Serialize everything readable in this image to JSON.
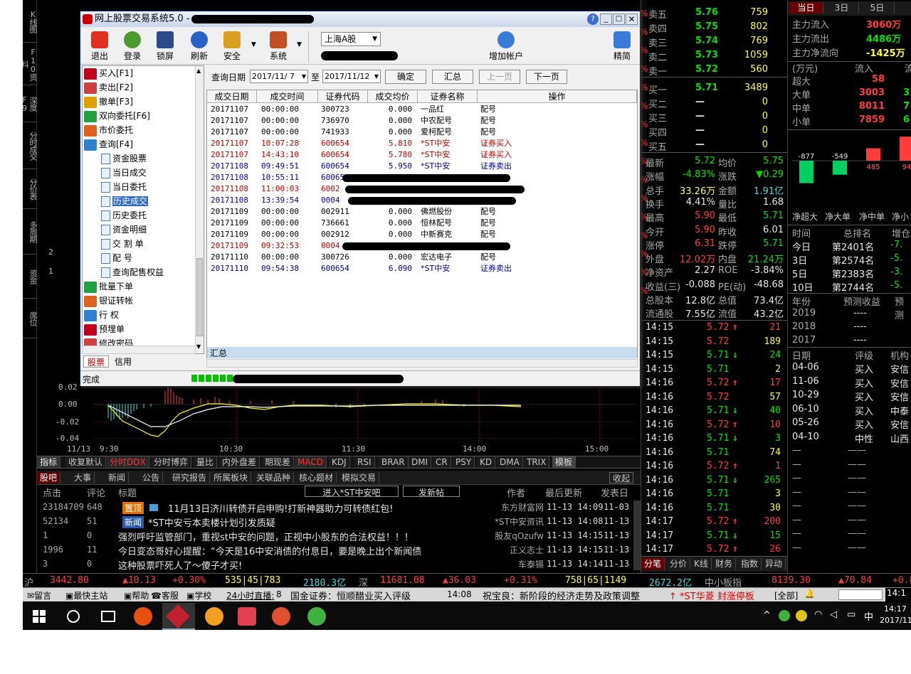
{
  "left_tabs": [
    "K线图",
    "F10资料",
    "深度F9",
    "分时成交",
    "分价表",
    "多周期",
    "资金",
    "席位"
  ],
  "chart": {
    "y_labels": [
      "0.02",
      "0.00",
      "-0.02",
      "-0.04"
    ],
    "x_labels": [
      "11/13",
      "9:30",
      "10:30",
      "11:30",
      "14:00",
      "15:00"
    ],
    "side_labels": [
      "2",
      "1"
    ]
  },
  "indicator_tabs": [
    "指标",
    "收复默认",
    "分时DDX",
    "分时博弈",
    "量比",
    "内外盘差",
    "期现差",
    "MACD",
    "KDJ",
    "RSI",
    "BRAR",
    "DMI",
    "CR",
    "PSY",
    "KD",
    "DMA",
    "TRIX",
    "模板"
  ],
  "news": {
    "tabs": [
      "股吧",
      "大事",
      "新闻",
      "公告",
      "研究报告",
      "所属板块",
      "关联品种",
      "核心题材",
      "模拟交易"
    ],
    "collapse": "收起",
    "headers": {
      "clicks": "点击",
      "comments": "评论",
      "title": "标题",
      "enter": "进入*ST中安吧",
      "post": "发新帖",
      "author": "作者",
      "updated": "最后更新",
      "posted": "发表日"
    },
    "rows": [
      {
        "clicks": "23184709",
        "comments": "648",
        "badge": "置顶",
        "title": "11月13日济川转债开启申购!打新神器助力可转债红包!",
        "author": "东方财富网",
        "updated": "11-13 14:09",
        "posted": "11-03"
      },
      {
        "clicks": "52134",
        "comments": "51",
        "badge": "新闻",
        "title": "*ST中安亏本卖楼计划引发质疑",
        "author": "*ST中安资讯",
        "updated": "11-13 14:08",
        "posted": "11-13"
      },
      {
        "clicks": "1",
        "comments": "0",
        "badge": "",
        "title": "强烈呼吁监管部门，重视st中安的问题，正视中小股东的合法权益！！！",
        "author": "股友qOzufw",
        "updated": "11-13 14:15",
        "posted": "11-13"
      },
      {
        "clicks": "1996",
        "comments": "11",
        "badge": "",
        "title": "今日变态哥好心提醒：“今天是16中安消债的付息日，要是晚上出个新闻债",
        "author": "正义志士",
        "updated": "11-13 14:15",
        "posted": "11-13"
      },
      {
        "clicks": "3",
        "comments": "0",
        "badge": "",
        "title": "这种股票吓死人了～傻子才买!",
        "author": "车泰锡",
        "updated": "11-13 14:14",
        "posted": "11-13"
      }
    ]
  },
  "quote": {
    "sell": [
      {
        "label": "卖五",
        "price": "5.76",
        "vol": "759"
      },
      {
        "label": "卖四",
        "price": "5.75",
        "vol": "802"
      },
      {
        "label": "卖三",
        "price": "5.74",
        "vol": "769"
      },
      {
        "label": "卖二",
        "price": "5.73",
        "vol": "1059"
      },
      {
        "label": "卖一",
        "price": "5.72",
        "vol": "560"
      }
    ],
    "buy": [
      {
        "label": "买一",
        "price": "5.71",
        "vol": "3489"
      },
      {
        "label": "买二",
        "price": "—",
        "vol": "0"
      },
      {
        "label": "买三",
        "price": "—",
        "vol": "0"
      },
      {
        "label": "买四",
        "price": "—",
        "vol": "0"
      },
      {
        "label": "买五",
        "price": "—",
        "vol": "0"
      }
    ],
    "stats": [
      {
        "l1": "最新",
        "v1": "5.72",
        "l2": "均价",
        "v2": "5.75"
      },
      {
        "l1": "涨幅",
        "v1": "-4.83%",
        "l2": "涨跌",
        "v2": "▼0.29"
      },
      {
        "l1": "总手",
        "v1": "33.26万",
        "l2": "金额",
        "v2": "1.91亿"
      },
      {
        "l1": "换手",
        "v1": "4.41%",
        "l2": "量比",
        "v2": "1.68"
      },
      {
        "l1": "最高",
        "v1": "5.90",
        "l2": "最低",
        "v2": "5.71"
      },
      {
        "l1": "今开",
        "v1": "5.90",
        "l2": "昨收",
        "v2": "6.01"
      },
      {
        "l1": "涨停",
        "v1": "6.31",
        "l2": "跌停",
        "v2": "5.71"
      },
      {
        "l1": "外盘",
        "v1": "12.02万",
        "l2": "内盘",
        "v2": "21.24万"
      },
      {
        "l1": "净资产",
        "v1": "2.27",
        "l2": "ROE",
        "v2": "-3.84%"
      },
      {
        "l1": "收益(三)",
        "v1": "-0.088",
        "l2": "PE(动)",
        "v2": "-48.68"
      },
      {
        "l1": "总股本",
        "v1": "12.8亿",
        "l2": "总值",
        "v2": "73.4亿"
      },
      {
        "l1": "流通股",
        "v1": "7.55亿",
        "l2": "流值",
        "v2": "43.2亿"
      }
    ],
    "ticks": [
      {
        "t": "14:15",
        "p": "5.72",
        "a": "↑",
        "v": "21"
      },
      {
        "t": "14:15",
        "p": "5.72",
        "a": "",
        "v": "189"
      },
      {
        "t": "14:15",
        "p": "5.71",
        "a": "↓",
        "v": "24"
      },
      {
        "t": "14:15",
        "p": "5.71",
        "a": "",
        "v": "2"
      },
      {
        "t": "14:16",
        "p": "5.72",
        "a": "↑",
        "v": "17"
      },
      {
        "t": "14:16",
        "p": "5.72",
        "a": "",
        "v": "57"
      },
      {
        "t": "14:16",
        "p": "5.71",
        "a": "↓",
        "v": "40"
      },
      {
        "t": "14:16",
        "p": "5.72",
        "a": "↑",
        "v": "10"
      },
      {
        "t": "14:16",
        "p": "5.71",
        "a": "↓",
        "v": "3"
      },
      {
        "t": "14:16",
        "p": "5.71",
        "a": "",
        "v": "74"
      },
      {
        "t": "14:16",
        "p": "5.72",
        "a": "↑",
        "v": "1"
      },
      {
        "t": "14:16",
        "p": "5.71",
        "a": "↓",
        "v": "265"
      },
      {
        "t": "14:16",
        "p": "5.71",
        "a": "",
        "v": "3"
      },
      {
        "t": "14:16",
        "p": "5.71",
        "a": "",
        "v": "30"
      },
      {
        "t": "14:17",
        "p": "5.72",
        "a": "↑",
        "v": "200"
      },
      {
        "t": "14:17",
        "p": "5.71",
        "a": "↓",
        "v": "15"
      },
      {
        "t": "14:17",
        "p": "5.72",
        "a": "↑",
        "v": "26"
      }
    ],
    "bottom_tabs": [
      "分笔",
      "分价",
      "K线",
      "财务",
      "指数",
      "异动"
    ],
    "side_pct": [
      "%",
      "%",
      "%",
      "%",
      "%",
      "%",
      "%",
      "%",
      "%",
      "%",
      "%",
      "%",
      "%",
      "%",
      "%",
      "%"
    ]
  },
  "fund": {
    "tabs": [
      "当日",
      "3日",
      "5日"
    ],
    "rows": [
      {
        "label": "主力流入",
        "value": "3060万"
      },
      {
        "label": "主力流出",
        "value": "4486万"
      },
      {
        "label": "主力净流向",
        "value": "-1425万"
      }
    ],
    "head": {
      "unit": "(万元)",
      "in": "流入",
      "out": "流"
    },
    "size_rows": [
      {
        "label": "超大",
        "in": "58",
        "out": ""
      },
      {
        "label": "大单",
        "in": "3003",
        "out": "3"
      },
      {
        "label": "中单",
        "in": "8011",
        "out": "7"
      },
      {
        "label": "小单",
        "in": "7859",
        "out": "6"
      }
    ],
    "bars": [
      {
        "label": "-877",
        "value": -877
      },
      {
        "label": "-549",
        "value": -549
      },
      {
        "label": "485",
        "value": 485
      },
      {
        "label": "94",
        "value": 940
      }
    ],
    "bar_labels": [
      "净超大",
      "净大单",
      "净中单",
      "净小"
    ],
    "rank_head": {
      "time": "时间",
      "rank": "总排名",
      "chg": "增仓"
    },
    "ranks": [
      {
        "t": "今日",
        "r": "第2401名",
        "c": "-7."
      },
      {
        "t": "3日",
        "r": "第2574名",
        "c": "-5."
      },
      {
        "t": "5日",
        "r": "第2383名",
        "c": "-3."
      },
      {
        "t": "10日",
        "r": "第2744名",
        "c": "-5."
      }
    ],
    "eps_head": {
      "year": "年份",
      "eps": "预测收益",
      "pred": "预测"
    },
    "eps": [
      {
        "y": "2019",
        "v": "----"
      },
      {
        "y": "2018",
        "v": "----"
      },
      {
        "y": "2017",
        "v": "----"
      }
    ],
    "rating_head": {
      "date": "日期",
      "rate": "评级",
      "org": "机构"
    },
    "ratings": [
      {
        "d": "04-06",
        "r": "买入",
        "o": "安信"
      },
      {
        "d": "11-06",
        "r": "买入",
        "o": "安信"
      },
      {
        "d": "10-29",
        "r": "买入",
        "o": "安信"
      },
      {
        "d": "06-10",
        "r": "买入",
        "o": "中泰"
      },
      {
        "d": "05-26",
        "r": "买入",
        "o": "安信"
      },
      {
        "d": "04-10",
        "r": "中性",
        "o": "山西"
      }
    ],
    "dashes": [
      "—",
      "—",
      "—",
      "—",
      "—",
      "—",
      "—",
      "—"
    ]
  },
  "status_bar": {
    "sh_label": "沪",
    "sh_index": "3442.80",
    "sh_chg": "▲10.13",
    "sh_pct": "+0.30%",
    "sh_updown": "535|45|783",
    "sh_amount": "2180.3亿",
    "sz_label": "深",
    "sz_index": "11681.08",
    "sz_chg": "▲36.03",
    "sz_pct": "+0.31%",
    "sz_updown": "758|65|1149",
    "sz_amount": "2672.2亿",
    "zxb_label": "中小板指",
    "zxb_index": "8139.30",
    "zxb_chg": "▲70.84",
    "zxb_pct": "+0.8"
  },
  "ticker": {
    "items": [
      "留言",
      "最快主站",
      "帮助",
      "客服",
      "学校"
    ],
    "live": "24小时直播:",
    "live_num": "8",
    "news1": "国金证券：恒顺醋业买入评级",
    "time1": "14:08",
    "news2": "祝宝良：新阶段的经济走势及政策调整",
    "alert": "↑ *ST华菱 封涨停板",
    "all": "[全部]",
    "clock": "14:1"
  },
  "taskbar": {
    "time": "14:17",
    "date": "2017/11",
    "ime": "中"
  },
  "dialog": {
    "title": "网上股票交易系统5.0 -",
    "toolbar": [
      "退出",
      "登录",
      "锁屏",
      "刷新",
      "安全",
      "系统",
      "增加帐户",
      "精简"
    ],
    "market": "上海A股",
    "tree": [
      {
        "label": "买入[F1]",
        "lvl": 0
      },
      {
        "label": "卖出[F2]",
        "lvl": 0
      },
      {
        "label": "撤单[F3]",
        "lvl": 0
      },
      {
        "label": "双向委托[F6]",
        "lvl": 0
      },
      {
        "label": "市价委托",
        "lvl": 0
      },
      {
        "label": "查询[F4]",
        "lvl": 0
      },
      {
        "label": "资金股票",
        "lvl": 1
      },
      {
        "label": "当日成交",
        "lvl": 1
      },
      {
        "label": "当日委托",
        "lvl": 1
      },
      {
        "label": "历史成交",
        "lvl": 1
      },
      {
        "label": "历史委托",
        "lvl": 1
      },
      {
        "label": "资金明细",
        "lvl": 1
      },
      {
        "label": "交 割 单",
        "lvl": 1
      },
      {
        "label": "配    号",
        "lvl": 1
      },
      {
        "label": "查询配售权益",
        "lvl": 1
      },
      {
        "label": "批量下单",
        "lvl": 0
      },
      {
        "label": "银证转帐",
        "lvl": 0
      },
      {
        "label": "行    权",
        "lvl": 0
      },
      {
        "label": "预埋单",
        "lvl": 0
      },
      {
        "label": "修改密码",
        "lvl": 0
      }
    ],
    "tree_tabs": [
      "股票",
      "信用"
    ],
    "query": {
      "label": "查询日期",
      "from": "2017/11/ 7",
      "to_label": "至",
      "to": "2017/11/12",
      "ok": "确定",
      "sum": "汇总",
      "prev": "上一页",
      "next": "下一页"
    },
    "columns": [
      "成交日期",
      "成交时间",
      "证券代码",
      "成交均价",
      "证券名称",
      "操作"
    ],
    "rows": [
      {
        "date": "20171107",
        "time": "00:00:00",
        "code": "300723",
        "price": "0.000",
        "name": "一品红",
        "op": "配号",
        "red": false,
        "blue": false
      },
      {
        "date": "20171107",
        "time": "00:00:00",
        "code": "736970",
        "price": "0.000",
        "name": "中农配号",
        "op": "配号",
        "red": false,
        "blue": false
      },
      {
        "date": "20171107",
        "time": "00:00:00",
        "code": "741933",
        "price": "0.000",
        "name": "爱柯配号",
        "op": "配号",
        "red": false,
        "blue": false
      },
      {
        "date": "20171107",
        "time": "10:07:28",
        "code": "600654",
        "price": "5.810",
        "name": "*ST中安",
        "op": "证券买入",
        "red": true,
        "blue": false
      },
      {
        "date": "20171107",
        "time": "14:43:10",
        "code": "600654",
        "price": "5.780",
        "name": "*ST中安",
        "op": "证券买入",
        "red": true,
        "blue": false
      },
      {
        "date": "20171108",
        "time": "09:49:51",
        "code": "600654",
        "price": "5.950",
        "name": "*ST中安",
        "op": "证券卖出",
        "red": false,
        "blue": true
      },
      {
        "date": "20171108",
        "time": "10:55:11",
        "code": "60065",
        "price": "",
        "name": "",
        "op": "",
        "red": false,
        "blue": true
      },
      {
        "date": "20171108",
        "time": "11:00:03",
        "code": "6002",
        "price": "",
        "name": "",
        "op": "",
        "red": true,
        "blue": false
      },
      {
        "date": "20171108",
        "time": "13:39:54",
        "code": "0004",
        "price": "",
        "name": "",
        "op": "",
        "red": false,
        "blue": true
      },
      {
        "date": "20171109",
        "time": "00:00:00",
        "code": "002911",
        "price": "0.000",
        "name": "佛燃股份",
        "op": "配号",
        "red": false,
        "blue": false
      },
      {
        "date": "20171109",
        "time": "00:00:00",
        "code": "736661",
        "price": "0.000",
        "name": "恒林配号",
        "op": "配号",
        "red": false,
        "blue": false
      },
      {
        "date": "20171109",
        "time": "00:00:00",
        "code": "002912",
        "price": "0.000",
        "name": "中新赛克",
        "op": "配号",
        "red": false,
        "blue": false
      },
      {
        "date": "20171109",
        "time": "09:32:53",
        "code": "0004",
        "price": "",
        "name": "",
        "op": "",
        "red": true,
        "blue": false
      },
      {
        "date": "20171110",
        "time": "00:00:00",
        "code": "300726",
        "price": "0.000",
        "name": "宏达电子",
        "op": "配号",
        "red": false,
        "blue": false
      },
      {
        "date": "20171110",
        "time": "09:54:38",
        "code": "600654",
        "price": "6.090",
        "name": "*ST中安",
        "op": "证券卖出",
        "red": false,
        "blue": true
      }
    ],
    "summary": "汇总",
    "status": "完成"
  }
}
